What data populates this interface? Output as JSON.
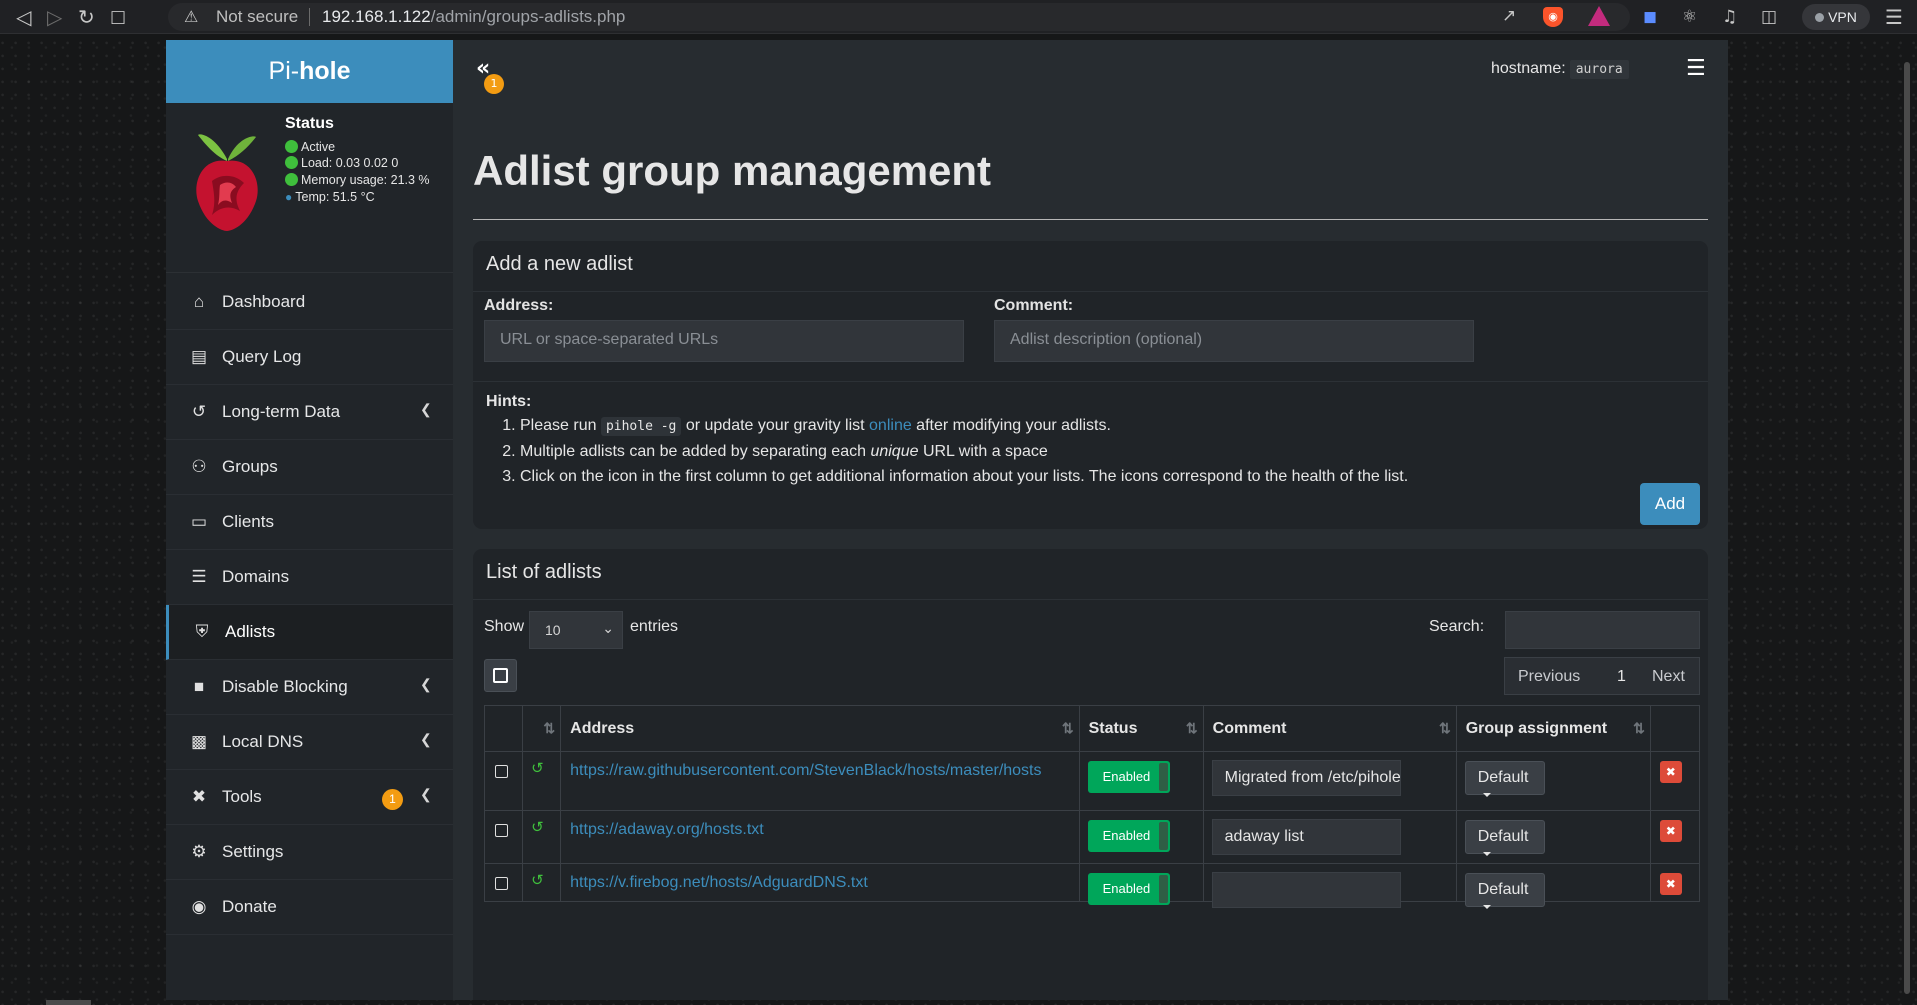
{
  "browser": {
    "security_label": "Not secure",
    "url_host": "192.168.1.122",
    "url_path": "/admin/groups-adlists.php",
    "vpn_label": "VPN"
  },
  "app": {
    "logo_prefix": "Pi-",
    "logo_bold": "hole",
    "status": {
      "title": "Status",
      "active": "Active",
      "load": "Load:  0.03  0.02  0",
      "memory": "Memory usage:  21.3 %",
      "temp": "Temp: 51.5 °C"
    },
    "menu": [
      {
        "label": "Dashboard"
      },
      {
        "label": "Query Log"
      },
      {
        "label": "Long-term Data"
      },
      {
        "label": "Groups"
      },
      {
        "label": "Clients"
      },
      {
        "label": "Domains"
      },
      {
        "label": "Adlists"
      },
      {
        "label": "Disable Blocking"
      },
      {
        "label": "Local DNS"
      },
      {
        "label": "Tools",
        "badge": "1"
      },
      {
        "label": "Settings"
      },
      {
        "label": "Donate"
      }
    ],
    "topbar": {
      "toggle_badge": "1",
      "hostname_label": "hostname:",
      "hostname_value": "aurora"
    },
    "page_title": "Adlist group management",
    "add_box": {
      "title": "Add a new adlist",
      "address_label": "Address:",
      "address_placeholder": "URL or space-separated URLs",
      "comment_label": "Comment:",
      "comment_placeholder": "Adlist description (optional)",
      "hints_title": "Hints:",
      "hint1_pre": "Please run ",
      "hint1_code": "pihole -g",
      "hint1_mid": " or update your gravity list ",
      "hint1_link": "online",
      "hint1_post": " after modifying your adlists.",
      "hint2_pre": "Multiple adlists can be added by separating each ",
      "hint2_em": "unique",
      "hint2_post": " URL with a space",
      "hint3": "Click on the icon in the first column to get additional information about your lists. The icons correspond to the health of the list.",
      "add_button": "Add"
    },
    "list_box": {
      "title": "List of adlists",
      "show_label": "Show",
      "entries_value": "10",
      "entries_label": "entries",
      "search_label": "Search:",
      "pager": {
        "previous": "Previous",
        "page": "1",
        "next": "Next"
      },
      "columns": [
        "Address",
        "Status",
        "Comment",
        "Group assignment"
      ],
      "rows": [
        {
          "address": "https://raw.githubusercontent.com/StevenBlack/hosts/master/hosts",
          "status": "Enabled",
          "comment": "Migrated from /etc/pihole/adlists.list",
          "group": "Default"
        },
        {
          "address": "https://adaway.org/hosts.txt",
          "status": "Enabled",
          "comment": "adaway list",
          "group": "Default"
        },
        {
          "address": "https://v.firebog.net/hosts/AdguardDNS.txt",
          "status": "Enabled",
          "comment": "",
          "group": "Default"
        }
      ]
    }
  },
  "colors": {
    "accent": "#3c8dbc",
    "enabled": "#00a65a",
    "danger": "#dd4b39",
    "badge": "#f39c12"
  }
}
